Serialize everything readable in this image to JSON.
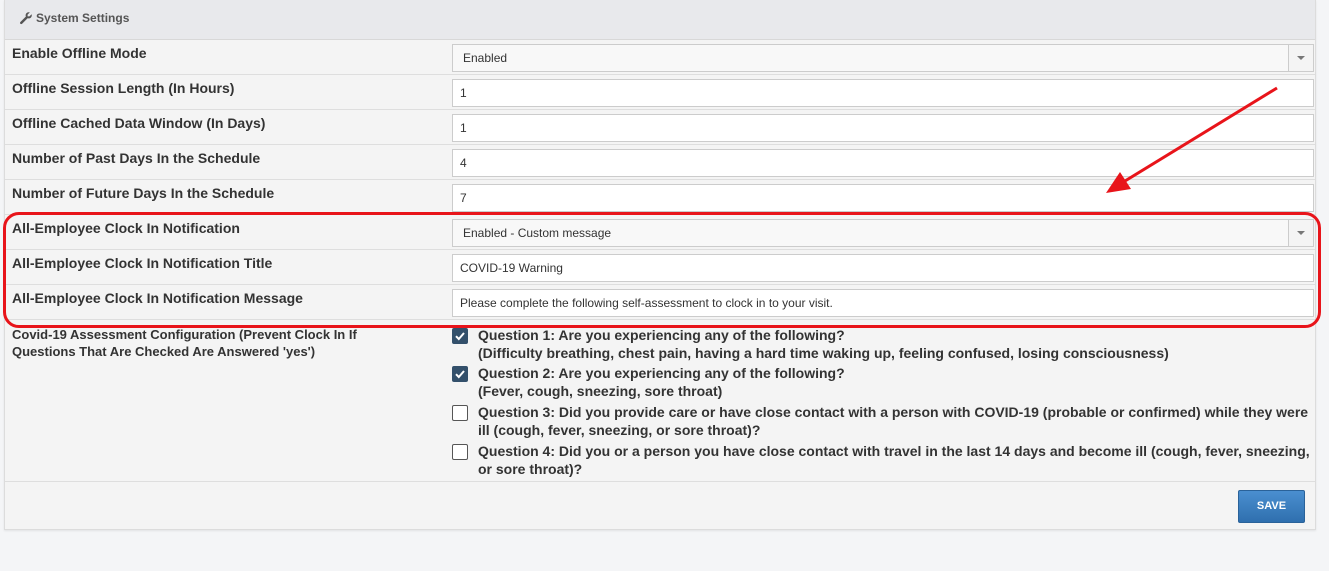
{
  "panel": {
    "title": "System Settings",
    "icon": "wrench-icon"
  },
  "settings": [
    {
      "label": "Enable Offline Mode",
      "type": "select",
      "value": "Enabled"
    },
    {
      "label": "Offline Session Length (In Hours)",
      "type": "text",
      "value": "1"
    },
    {
      "label": "Offline Cached Data Window (In Days)",
      "type": "text",
      "value": "1"
    },
    {
      "label": "Number of Past Days In the Schedule",
      "type": "text",
      "value": "4"
    },
    {
      "label": "Number of Future Days In the Schedule",
      "type": "text",
      "value": "7"
    },
    {
      "label": "All-Employee Clock In Notification",
      "type": "select",
      "value": "Enabled - Custom message"
    },
    {
      "label": "All-Employee Clock In Notification Title",
      "type": "text",
      "value": "COVID-19 Warning"
    },
    {
      "label": "All-Employee Clock In Notification Message",
      "type": "text",
      "value": "Please complete the following self-assessment to clock in to your visit."
    }
  ],
  "covid": {
    "label": "Covid-19 Assessment Configuration (Prevent Clock In If Questions That Are Checked Are Answered 'yes')",
    "questions": [
      {
        "text": "Question 1: Are you experiencing any of the following?",
        "detail": "(Difficulty breathing, chest pain, having a hard time waking up, feeling confused, losing consciousness)",
        "checked": true
      },
      {
        "text": "Question 2: Are you experiencing any of the following?",
        "detail": "(Fever, cough, sneezing, sore throat)",
        "checked": true
      },
      {
        "text": "Question 3: Did you provide care or have close contact with a person with COVID-19 (probable or confirmed) while they were ill (cough, fever, sneezing, or sore throat)?",
        "detail": "",
        "checked": false
      },
      {
        "text": "Question 4: Did you or a person you have close contact with travel in the last 14 days and become ill (cough, fever, sneezing, or sore throat)?",
        "detail": "",
        "checked": false
      }
    ]
  },
  "buttons": {
    "save": "SAVE"
  },
  "annotation": {
    "color": "#e8141a"
  }
}
